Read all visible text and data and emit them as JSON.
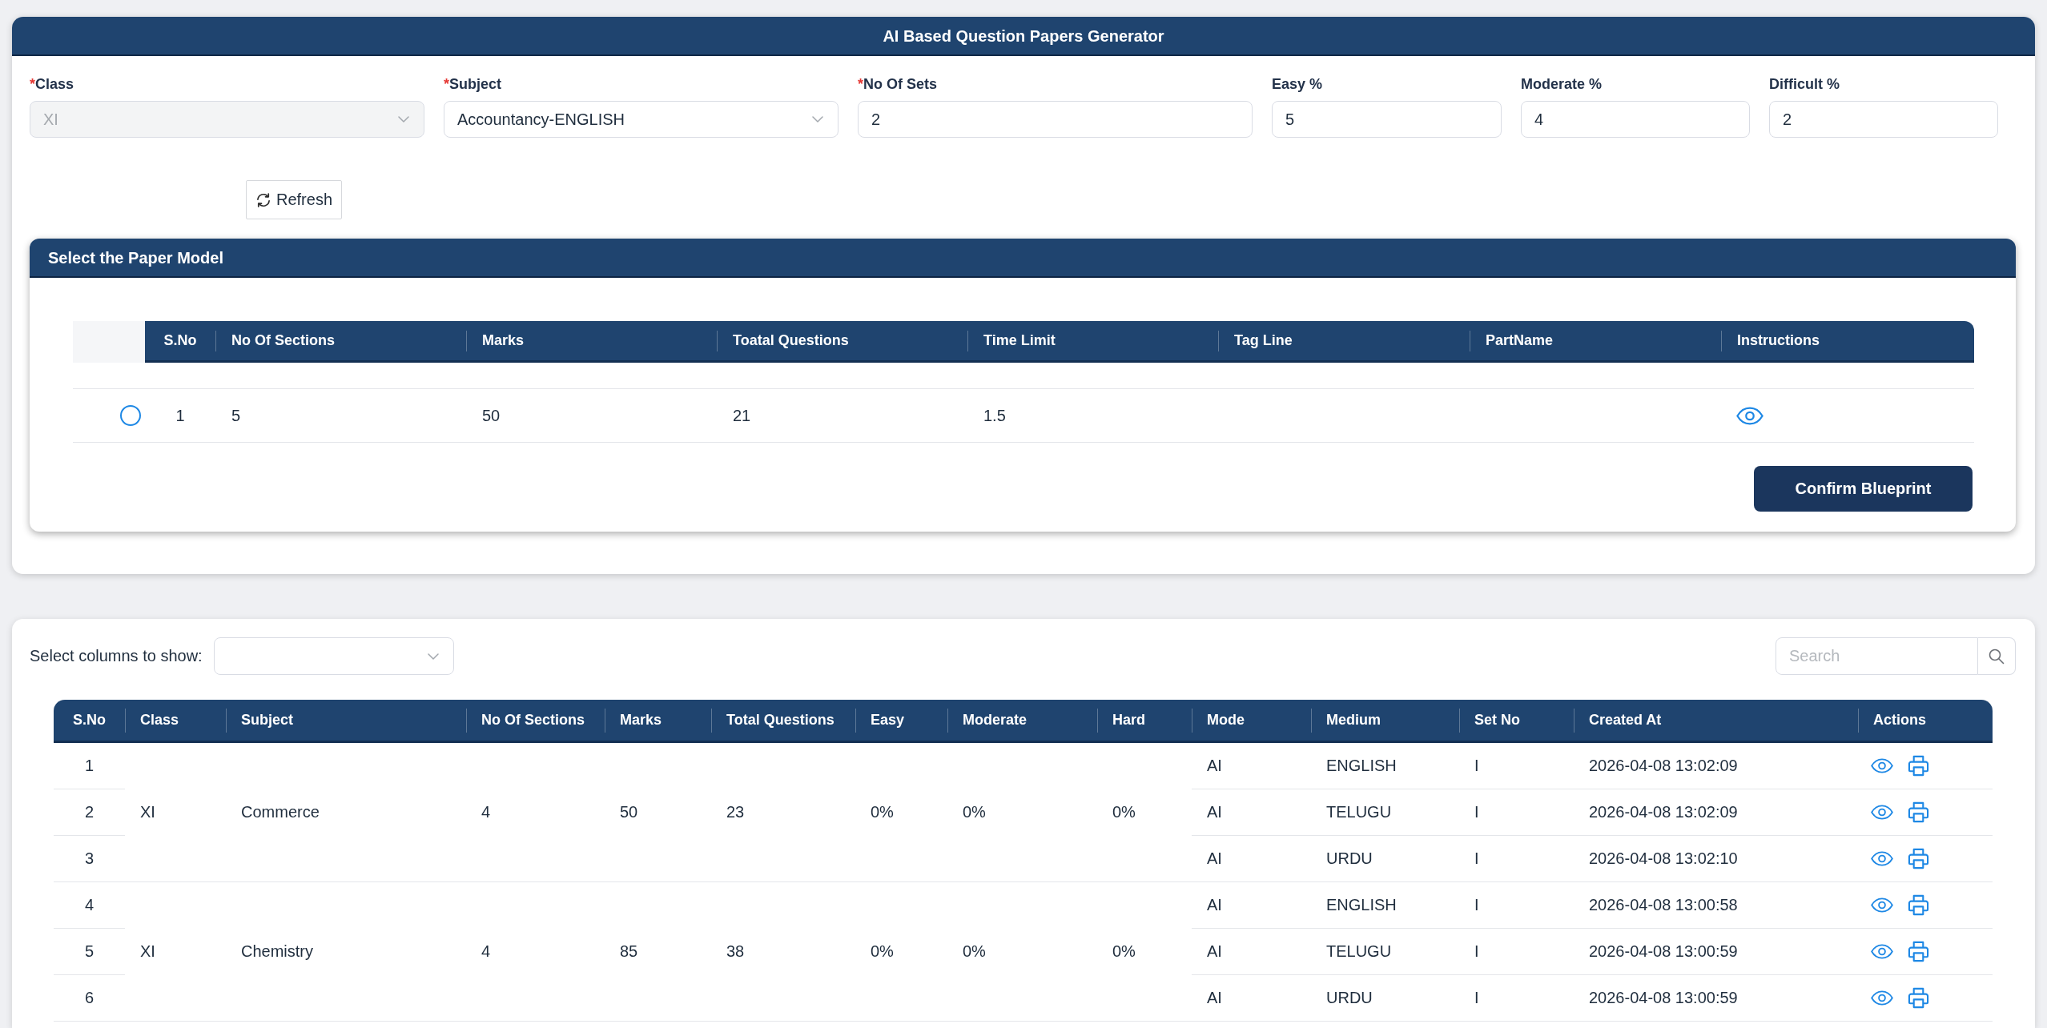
{
  "window": {
    "title": "AI Based Question Papers Generator"
  },
  "form": {
    "fields": [
      {
        "kind": "select",
        "label": "Class",
        "required_mark": "*",
        "value": "XI",
        "disabled": true
      },
      {
        "kind": "select",
        "label": "Subject",
        "required_mark": "*",
        "value": "Accountancy-ENGLISH",
        "disabled": false
      },
      {
        "kind": "input",
        "label": "No Of Sets",
        "required_mark": "*",
        "value": "2",
        "disabled": false
      },
      {
        "kind": "input",
        "label": "Easy %",
        "value": "5",
        "disabled": false
      },
      {
        "kind": "input",
        "label": "Moderate %",
        "value": "4",
        "disabled": false
      },
      {
        "kind": "input",
        "label": "Difficult %",
        "value": "2",
        "disabled": false
      }
    ],
    "refresh_button": "Refresh"
  },
  "paper_model": {
    "title": "Select the Paper Model",
    "columns": [
      "S.No",
      "No Of Sections",
      "Marks",
      "Toatal Questions",
      "Time Limit",
      "Tag Line",
      "PartName",
      "Instructions"
    ],
    "rows": [
      {
        "selected": false,
        "s_no": "1",
        "sections": "5",
        "marks": "50",
        "total_questions": "21",
        "time_limit": "1.5"
      }
    ],
    "confirm_button": "Confirm Blueprint"
  },
  "records": {
    "column_picker": {
      "label": "Select columns to show:"
    },
    "search": {
      "placeholder": "Search"
    },
    "columns": [
      "S.No",
      "Class",
      "Subject",
      "No Of Sections",
      "Marks",
      "Total Questions",
      "Easy",
      "Moderate",
      "Hard",
      "Mode",
      "Medium",
      "Set No",
      "Created At",
      "Actions"
    ],
    "groups": [
      {
        "class": "XI",
        "subject": "Commerce",
        "sections": "4",
        "marks": "50",
        "total_questions": "23",
        "easy": "0%",
        "moderate": "0%",
        "hard": "0%",
        "rows": [
          {
            "s_no": "1",
            "mode": "AI",
            "medium": "ENGLISH",
            "set_no": "I",
            "created_at": "2026-04-08 13:02:09"
          },
          {
            "s_no": "2",
            "mode": "AI",
            "medium": "TELUGU",
            "set_no": "I",
            "created_at": "2026-04-08 13:02:09"
          },
          {
            "s_no": "3",
            "mode": "AI",
            "medium": "URDU",
            "set_no": "I",
            "created_at": "2026-04-08 13:02:10"
          }
        ]
      },
      {
        "class": "XI",
        "subject": "Chemistry",
        "sections": "4",
        "marks": "85",
        "total_questions": "38",
        "easy": "0%",
        "moderate": "0%",
        "hard": "0%",
        "rows": [
          {
            "s_no": "4",
            "mode": "AI",
            "medium": "ENGLISH",
            "set_no": "I",
            "created_at": "2026-04-08 13:00:58"
          },
          {
            "s_no": "5",
            "mode": "AI",
            "medium": "TELUGU",
            "set_no": "I",
            "created_at": "2026-04-08 13:00:59"
          },
          {
            "s_no": "6",
            "mode": "AI",
            "medium": "URDU",
            "set_no": "I",
            "created_at": "2026-04-08 13:00:59"
          }
        ]
      }
    ]
  }
}
